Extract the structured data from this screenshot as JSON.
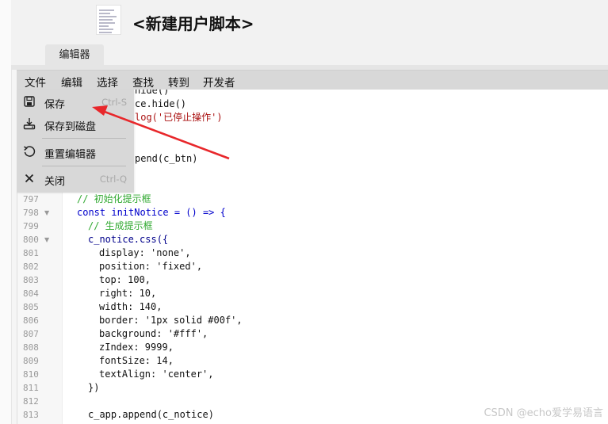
{
  "page": {
    "title": "<新建用户脚本>",
    "tab_label": "编辑器"
  },
  "menubar": {
    "items": [
      "文件",
      "编辑",
      "选择",
      "查找",
      "转到",
      "开发者"
    ]
  },
  "file_menu": {
    "items": [
      {
        "label": "保存",
        "shortcut": "Ctrl-S",
        "icon": "save-icon"
      },
      {
        "label": "保存到磁盘",
        "shortcut": "",
        "icon": "save-to-disk-icon"
      },
      {
        "label": "重置编辑器",
        "shortcut": "",
        "icon": "reset-icon"
      },
      {
        "label": "关闭",
        "shortcut": "Ctrl-Q",
        "icon": "close-icon"
      }
    ]
  },
  "editor": {
    "partial_lines": [
      {
        "text": "hide()"
      },
      {
        "text": "ce.hide()"
      },
      {
        "text": "log('已停止操作')"
      },
      {
        "text": "pend(c_btn)"
      }
    ],
    "lines": [
      {
        "num": "797",
        "fold": false,
        "text": "// 初始化提示框"
      },
      {
        "num": "798",
        "fold": true,
        "text": "const initNotice = () => {"
      },
      {
        "num": "799",
        "fold": false,
        "text": "// 生成提示框"
      },
      {
        "num": "800",
        "fold": true,
        "text": "c_notice.css({"
      },
      {
        "num": "801",
        "fold": false,
        "text": "display: 'none',"
      },
      {
        "num": "802",
        "fold": false,
        "text": "position: 'fixed',"
      },
      {
        "num": "803",
        "fold": false,
        "text": "top: 100,"
      },
      {
        "num": "804",
        "fold": false,
        "text": "right: 10,"
      },
      {
        "num": "805",
        "fold": false,
        "text": "width: 140,"
      },
      {
        "num": "806",
        "fold": false,
        "text": "border: '1px solid #00f',"
      },
      {
        "num": "807",
        "fold": false,
        "text": "background: '#fff',"
      },
      {
        "num": "808",
        "fold": false,
        "text": "zIndex: 9999,"
      },
      {
        "num": "809",
        "fold": false,
        "text": "fontSize: 14,"
      },
      {
        "num": "810",
        "fold": false,
        "text": "textAlign: 'center',"
      },
      {
        "num": "811",
        "fold": false,
        "text": "})"
      },
      {
        "num": "812",
        "fold": false,
        "text": ""
      },
      {
        "num": "813",
        "fold": false,
        "text": "c_app.append(c_notice)"
      }
    ]
  },
  "watermark": "CSDN @echo爱学易语言",
  "colors": {
    "arrow": "#e8272b",
    "menu_bg": "#d8d8d8",
    "comment": "#33aa33",
    "keyword": "#0000cc"
  }
}
